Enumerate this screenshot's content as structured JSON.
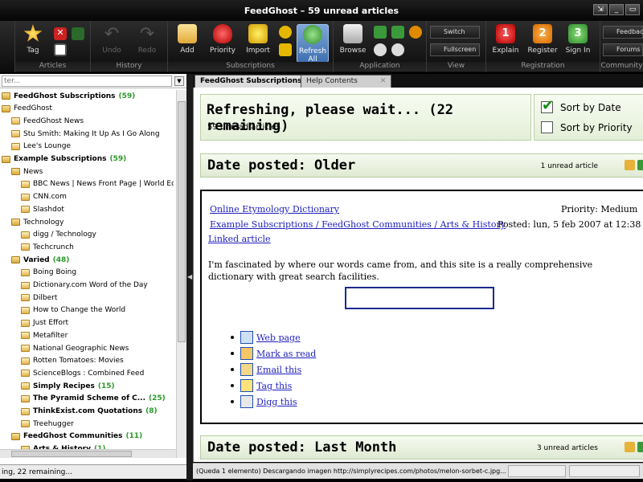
{
  "window": {
    "title": "FeedGhost  – 59 unread articles"
  },
  "ribbon": {
    "groups": [
      "Articles",
      "History",
      "Subscriptions",
      "Application",
      "View",
      "Registration",
      "Community"
    ],
    "buttons": {
      "tag": "Tag",
      "undo": "Undo",
      "redo": "Redo",
      "add": "Add",
      "priority": "Priority",
      "import": "Import",
      "refresh_all": "Refresh All",
      "browse": "Browse",
      "switch": "Switch",
      "fullscreen": "Fullscreen",
      "explain": "Explain",
      "register": "Register",
      "sign_in": "Sign In",
      "feedback": "Feedback",
      "forums": "Forums"
    },
    "step_numbers": [
      "1",
      "2",
      "3"
    ]
  },
  "filter": {
    "placeholder": "ter..."
  },
  "tree": [
    {
      "label": "FeedGhost Subscriptions",
      "count": "(59)",
      "bold": true,
      "level": 0,
      "icon": "folder"
    },
    {
      "label": "FeedGhost",
      "count": "",
      "bold": false,
      "level": 0,
      "icon": "folder"
    },
    {
      "label": "FeedGhost News",
      "count": "",
      "bold": false,
      "level": 1,
      "icon": "feed"
    },
    {
      "label": "Stu Smith: Making It Up As I Go Along",
      "count": "",
      "bold": false,
      "level": 1,
      "icon": "feed"
    },
    {
      "label": "Lee's Lounge",
      "count": "",
      "bold": false,
      "level": 1,
      "icon": "feed"
    },
    {
      "label": "Example Subscriptions",
      "count": "(59)",
      "bold": true,
      "level": 0,
      "icon": "folder"
    },
    {
      "label": "News",
      "count": "",
      "bold": false,
      "level": 1,
      "icon": "folder"
    },
    {
      "label": "BBC News | News Front Page | World Ed...",
      "count": "",
      "bold": false,
      "level": 2,
      "icon": "feed"
    },
    {
      "label": "CNN.com",
      "count": "",
      "bold": false,
      "level": 2,
      "icon": "feed"
    },
    {
      "label": "Slashdot",
      "count": "",
      "bold": false,
      "level": 2,
      "icon": "feed"
    },
    {
      "label": "Technology",
      "count": "",
      "bold": false,
      "level": 1,
      "icon": "folder"
    },
    {
      "label": "digg / Technology",
      "count": "",
      "bold": false,
      "level": 2,
      "icon": "feed"
    },
    {
      "label": "Techcrunch",
      "count": "",
      "bold": false,
      "level": 2,
      "icon": "feed"
    },
    {
      "label": "Varied",
      "count": "(48)",
      "bold": true,
      "level": 1,
      "icon": "folder"
    },
    {
      "label": "Boing Boing",
      "count": "",
      "bold": false,
      "level": 2,
      "icon": "feed"
    },
    {
      "label": "Dictionary.com Word of the Day",
      "count": "",
      "bold": false,
      "level": 2,
      "icon": "feed"
    },
    {
      "label": "Dilbert",
      "count": "",
      "bold": false,
      "level": 2,
      "icon": "feed"
    },
    {
      "label": "How to Change the World",
      "count": "",
      "bold": false,
      "level": 2,
      "icon": "feed"
    },
    {
      "label": "Just Effort",
      "count": "",
      "bold": false,
      "level": 2,
      "icon": "feed"
    },
    {
      "label": "Metafilter",
      "count": "",
      "bold": false,
      "level": 2,
      "icon": "feed"
    },
    {
      "label": "National Geographic News",
      "count": "",
      "bold": false,
      "level": 2,
      "icon": "feed"
    },
    {
      "label": "Rotten Tomatoes: Movies",
      "count": "",
      "bold": false,
      "level": 2,
      "icon": "feed"
    },
    {
      "label": "ScienceBlogs : Combined Feed",
      "count": "",
      "bold": false,
      "level": 2,
      "icon": "feed"
    },
    {
      "label": "Simply Recipes",
      "count": "(15)",
      "bold": true,
      "level": 2,
      "icon": "feed"
    },
    {
      "label": "The Pyramid Scheme of C...",
      "count": "(25)",
      "bold": true,
      "level": 2,
      "icon": "feed"
    },
    {
      "label": "ThinkExist.com Quotations",
      "count": "(8)",
      "bold": true,
      "level": 2,
      "icon": "feed"
    },
    {
      "label": "Treehugger",
      "count": "",
      "bold": false,
      "level": 2,
      "icon": "feed"
    },
    {
      "label": "FeedGhost Communities",
      "count": "(11)",
      "bold": true,
      "level": 1,
      "icon": "folder"
    },
    {
      "label": "Arts & History",
      "count": "(1)",
      "bold": true,
      "level": 2,
      "icon": "folder"
    }
  ],
  "left_status": "ing, 22 remaining...",
  "tabs": [
    {
      "label": "FeedGhost Subscriptions"
    },
    {
      "label": "Help Contents"
    }
  ],
  "refresh": {
    "heading": "Refreshing, please wait... (22 remaining)",
    "sub": "59 unread articles",
    "sort_date": "Sort by Date",
    "sort_priority": "Sort by Priority"
  },
  "date_older": {
    "heading": "Date posted: Older",
    "unread": "1 unread article"
  },
  "article": {
    "title_link": "Online Etymology Dictionary",
    "category_link": "Example Subscriptions / FeedGhost Communities / Arts & History",
    "linked": "Linked article",
    "priority": "Priority: Medium",
    "posted": "Posted: lun, 5 feb 2007 at 12:38",
    "body": "I'm fascinated by where our words came from, and this site is a really comprehensive dictionary with great search facilities.",
    "actions": [
      "Web page",
      "Mark as read",
      "Email this",
      "Tag this",
      "Digg this"
    ]
  },
  "date_month": {
    "heading": "Date posted: Last Month",
    "unread": "3 unread articles"
  },
  "status": "(Queda 1 elemento) Descargando imagen http://simplyrecipes.com/photos/melon-sorbet-c.jpg..."
}
